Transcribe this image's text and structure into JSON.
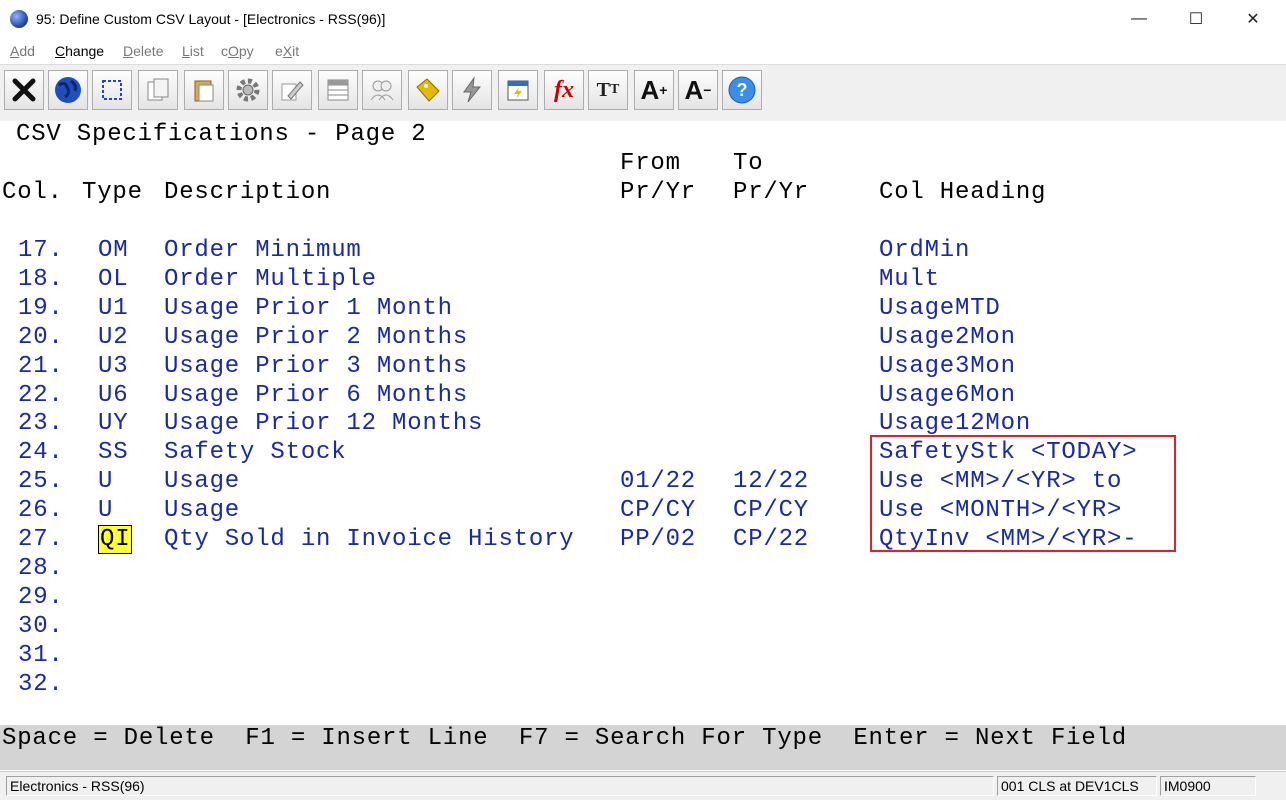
{
  "window": {
    "title": "95: Define Custom CSV Layout - [Electronics - RSS(96)]",
    "minimize": "—",
    "maximize": "☐",
    "close": "✕"
  },
  "menu": [
    {
      "pre": "",
      "u": "A",
      "post": "dd",
      "active": false
    },
    {
      "pre": "",
      "u": "C",
      "post": "hange",
      "active": true
    },
    {
      "pre": "",
      "u": "D",
      "post": "elete",
      "active": false
    },
    {
      "pre": "",
      "u": "L",
      "post": "ist",
      "active": false
    },
    {
      "pre": "c",
      "u": "O",
      "post": "py",
      "active": false
    },
    {
      "pre": "e",
      "u": "X",
      "post": "it",
      "active": false
    }
  ],
  "toolbar_icons": [
    "close-x-icon",
    "globe-icon",
    "select-icon",
    "copy-pages-icon",
    "clipboard-icon",
    "gear-icon",
    "edit-icon",
    "grid-icon",
    "people-icon",
    "tag-icon",
    "lightning-icon",
    "calendar-icon",
    "function-icon",
    "text-size-icon",
    "font-increase-icon",
    "font-decrease-icon",
    "help-icon"
  ],
  "screen": {
    "title": "CSV Specifications - Page 2",
    "headers": {
      "col": "Col.",
      "type": "Type",
      "description": "Description",
      "from_top": "From",
      "from_bottom": "Pr/Yr",
      "to_top": "To",
      "to_bottom": "Pr/Yr",
      "heading": "Col Heading"
    },
    "rows": [
      {
        "col": "17.",
        "type": "OM",
        "desc": "Order Minimum",
        "from": "",
        "to": "",
        "heading": "OrdMin"
      },
      {
        "col": "18.",
        "type": "OL",
        "desc": "Order Multiple",
        "from": "",
        "to": "",
        "heading": "Mult"
      },
      {
        "col": "19.",
        "type": "U1",
        "desc": "Usage Prior 1 Month",
        "from": "",
        "to": "",
        "heading": "UsageMTD"
      },
      {
        "col": "20.",
        "type": "U2",
        "desc": "Usage Prior 2 Months",
        "from": "",
        "to": "",
        "heading": "Usage2Mon"
      },
      {
        "col": "21.",
        "type": "U3",
        "desc": "Usage Prior 3 Months",
        "from": "",
        "to": "",
        "heading": "Usage3Mon"
      },
      {
        "col": "22.",
        "type": "U6",
        "desc": "Usage Prior 6 Months",
        "from": "",
        "to": "",
        "heading": "Usage6Mon"
      },
      {
        "col": "23.",
        "type": "UY",
        "desc": "Usage Prior 12 Months",
        "from": "",
        "to": "",
        "heading": "Usage12Mon"
      },
      {
        "col": "24.",
        "type": "SS",
        "desc": "Safety Stock",
        "from": "",
        "to": "",
        "heading": "SafetyStk <TODAY>"
      },
      {
        "col": "25.",
        "type": "U",
        "desc": "Usage",
        "from": "01/22",
        "to": "12/22",
        "heading": "Use <MM>/<YR> to"
      },
      {
        "col": "26.",
        "type": "U",
        "desc": "Usage",
        "from": "CP/CY",
        "to": "CP/CY",
        "heading": "Use <MONTH>/<YR>"
      },
      {
        "col": "27.",
        "type": "QI",
        "desc": "Qty Sold in Invoice History",
        "from": "PP/02",
        "to": "CP/22",
        "heading": "QtyInv <MM>/<YR>-",
        "active": true
      },
      {
        "col": "28.",
        "type": "",
        "desc": "",
        "from": "",
        "to": "",
        "heading": ""
      },
      {
        "col": "29.",
        "type": "",
        "desc": "",
        "from": "",
        "to": "",
        "heading": ""
      },
      {
        "col": "30.",
        "type": "",
        "desc": "",
        "from": "",
        "to": "",
        "heading": ""
      },
      {
        "col": "31.",
        "type": "",
        "desc": "",
        "from": "",
        "to": "",
        "heading": ""
      },
      {
        "col": "32.",
        "type": "",
        "desc": "",
        "from": "",
        "to": "",
        "heading": ""
      }
    ]
  },
  "fkeys": "Space = Delete  F1 = Insert Line  F7 = Search For Type  Enter = Next Field",
  "status": {
    "left": "Electronics - RSS(96)",
    "session": "001 CLS at DEV1CLS",
    "program": "IM0900"
  },
  "colors": {
    "accent_highlight": "#ffff33",
    "terminal_text": "#1a2aa0",
    "annotation_box": "#e0202a"
  }
}
